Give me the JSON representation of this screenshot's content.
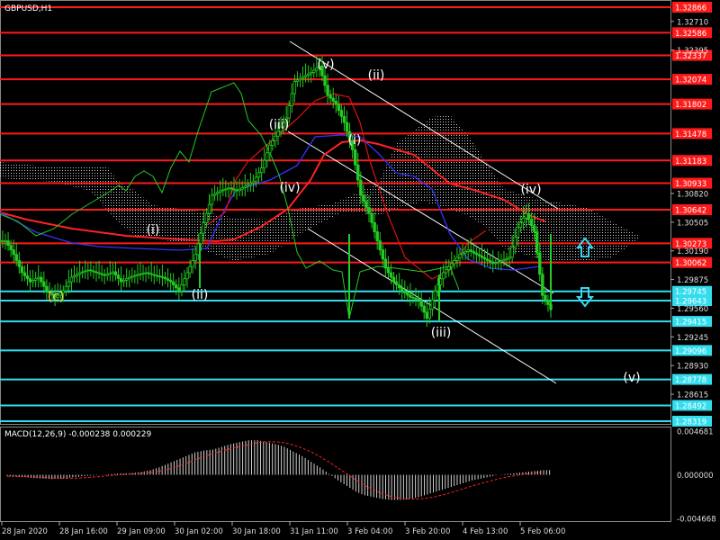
{
  "chart_data": {
    "type": "candlestick",
    "symbol_label": "GBPUSD,H1",
    "indicator_label": "MACD(12,26,9) -0.000238 0.000229",
    "price_axis": {
      "range": [
        1.282,
        1.329
      ],
      "tick_labels": [
        "1.32710",
        "1.32395",
        "1.30820",
        "1.30505",
        "1.30190",
        "1.29875",
        "1.29560",
        "1.29245",
        "1.28930",
        "1.28615"
      ]
    },
    "level_lines": {
      "resistance_color": "#ff1a1a",
      "support_color": "#33ddee",
      "resistance": [
        "1.32866",
        "1.32586",
        "1.32337",
        "1.32074",
        "1.31802",
        "1.31478",
        "1.31183",
        "1.30933",
        "1.30642",
        "1.30273",
        "1.30062"
      ],
      "support": [
        "1.29745",
        "1.29643",
        "1.29415",
        "1.29096",
        "1.28778",
        "1.28492",
        "1.28319"
      ]
    },
    "time_axis": [
      "28 Jan 2020",
      "28 Jan 16:00",
      "29 Jan 09:00",
      "30 Jan 02:00",
      "30 Jan 18:00",
      "31 Jan 11:00",
      "3 Feb 04:00",
      "3 Feb 20:00",
      "4 Feb 13:00",
      "5 Feb 06:00"
    ],
    "wave_labels": [
      {
        "text": "(c)",
        "color": "#ffd24a"
      },
      {
        "text": "(ii)",
        "color": "#ffffff"
      },
      {
        "text": "(i)",
        "color": "#ffffff"
      },
      {
        "text": "(iii)",
        "color": "#ffffff"
      },
      {
        "text": "(iv)",
        "color": "#ffffff"
      },
      {
        "text": "(v)",
        "color": "#ffffff"
      },
      {
        "text": "(ii)",
        "color": "#ffffff"
      },
      {
        "text": "(i)",
        "color": "#ffffff"
      },
      {
        "text": "(iii)",
        "color": "#ffffff"
      },
      {
        "text": "(iv)",
        "color": "#ffffff"
      },
      {
        "text": "(v)",
        "color": "#ffffff"
      }
    ],
    "price_path": [
      1.303,
      1.3015,
      1.2995,
      1.2985,
      1.299,
      1.2975,
      1.2968,
      1.2975,
      1.299,
      1.2995,
      1.2998,
      1.2995,
      1.2992,
      1.2996,
      1.2985,
      1.299,
      1.2993,
      1.2995,
      1.2992,
      1.299,
      1.2985,
      1.2975,
      1.2995,
      1.3015,
      1.305,
      1.308,
      1.3085,
      1.3088,
      1.3085,
      1.309,
      1.3095,
      1.311,
      1.3135,
      1.315,
      1.3165,
      1.3205,
      1.321,
      1.3215,
      1.3222,
      1.319,
      1.318,
      1.316,
      1.313,
      1.308,
      1.306,
      1.303,
      1.3,
      1.2985,
      1.2975,
      1.2968,
      1.2965,
      1.2945,
      1.2975,
      1.2995,
      1.3005,
      1.3015,
      1.302,
      1.3015,
      1.301,
      1.3005,
      1.3008,
      1.3012,
      1.3045,
      1.306,
      1.304,
      1.297,
      1.2955
    ],
    "macd_histogram": [
      -0.00015,
      -0.0002,
      -0.00025,
      -0.00035,
      -0.0004,
      -0.00045,
      -0.0004,
      -0.0003,
      -0.0002,
      -0.0001,
      -5e-05,
      5e-05,
      0.0001,
      0.00015,
      0.0002,
      0.0003,
      0.0005,
      0.0008,
      0.0012,
      0.0016,
      0.002,
      0.0024,
      0.0026,
      0.0027,
      0.003,
      0.0033,
      0.0035,
      0.0037,
      0.0037,
      0.0035,
      0.0033,
      0.003,
      0.0025,
      0.002,
      0.0014,
      0.0008,
      0.0001,
      -0.0006,
      -0.0012,
      -0.0018,
      -0.0022,
      -0.0024,
      -0.0026,
      -0.0027,
      -0.0027,
      -0.0026,
      -0.0024,
      -0.0021,
      -0.0018,
      -0.0015,
      -0.0012,
      -0.0009,
      -0.0006,
      -0.0004,
      -0.0002,
      0.0,
      0.0001,
      0.0002,
      0.0003,
      0.0004,
      0.0005
    ],
    "macd_axis": {
      "tick_labels": [
        "0.004681",
        "0.000000",
        "-0.004668"
      ],
      "range": [
        -0.004668,
        0.004681
      ]
    },
    "colors": {
      "candles": "#22cc22",
      "channel": "#ffffff",
      "tenkan": "#3333ff",
      "kijun": "#ff2222",
      "chikou": "#22cc22",
      "cloud": "#ffffff",
      "arrow": "#3bd6f0",
      "background": "#000000"
    }
  }
}
